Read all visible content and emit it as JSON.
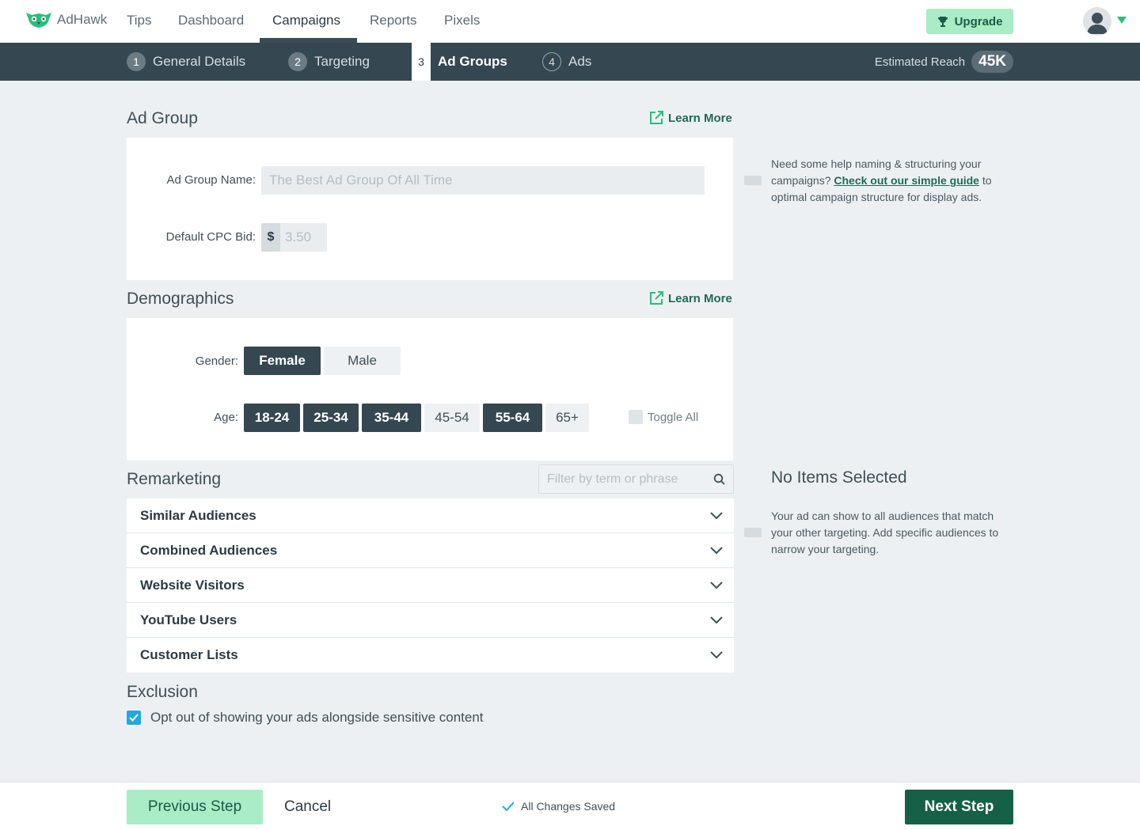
{
  "app": {
    "name": "AdHawk",
    "nav": [
      "Tips",
      "Dashboard",
      "Campaigns",
      "Reports",
      "Pixels"
    ],
    "active_nav": "Campaigns",
    "upgrade_label": "Upgrade"
  },
  "steps": [
    {
      "num": "1",
      "label": "General Details"
    },
    {
      "num": "2",
      "label": "Targeting"
    },
    {
      "num": "3",
      "label": "Ad Groups"
    },
    {
      "num": "4",
      "label": "Ads"
    }
  ],
  "active_step": "Ad Groups",
  "reach": {
    "label": "Estimated Reach",
    "value": "45K"
  },
  "ad_group": {
    "title": "Ad Group",
    "learn_more": "Learn More",
    "name_label": "Ad Group Name:",
    "name_value": "",
    "name_placeholder": "The Best Ad Group Of All Time",
    "cpc_label": "Default CPC Bid:",
    "cpc_prefix": "$",
    "cpc_value": "",
    "cpc_placeholder": "3.50",
    "help_before": "Need some help naming & structuring your campaigns?",
    "help_link": "Check out our simple guide",
    "help_after": "to optimal campaign structure for display ads."
  },
  "demographics": {
    "title": "Demographics",
    "learn_more": "Learn More",
    "gender_label": "Gender:",
    "genders": [
      {
        "label": "Female",
        "selected": true
      },
      {
        "label": "Male",
        "selected": false
      }
    ],
    "age_label": "Age:",
    "ages": [
      {
        "label": "18-24",
        "selected": true
      },
      {
        "label": "25-34",
        "selected": true
      },
      {
        "label": "35-44",
        "selected": true
      },
      {
        "label": "45-54",
        "selected": false
      },
      {
        "label": "55-64",
        "selected": true
      },
      {
        "label": "65+",
        "selected": false
      }
    ],
    "toggle_all": "Toggle All"
  },
  "remarketing": {
    "title": "Remarketing",
    "filter_placeholder": "Filter by term or phrase",
    "filter_value": "",
    "groups": [
      "Similar Audiences",
      "Combined Audiences",
      "Website Visitors",
      "YouTube Users",
      "Customer Lists"
    ],
    "side_title": "No Items Selected",
    "side_text": "Your ad can show to all audiences that match your other targeting. Add specific audiences to narrow your targeting."
  },
  "exclusion": {
    "title": "Exclusion",
    "opt_out_label": "Opt out of showing your ads alongside sensitive content",
    "opt_out_checked": true
  },
  "footer": {
    "previous": "Previous Step",
    "cancel": "Cancel",
    "saved": "All Changes Saved",
    "next": "Next Step"
  },
  "colors": {
    "accent": "#2bbd7e",
    "dark": "#354750",
    "primary_button": "#176048",
    "light_green": "#a9ecc6",
    "checkbox_blue": "#23a9e1"
  }
}
